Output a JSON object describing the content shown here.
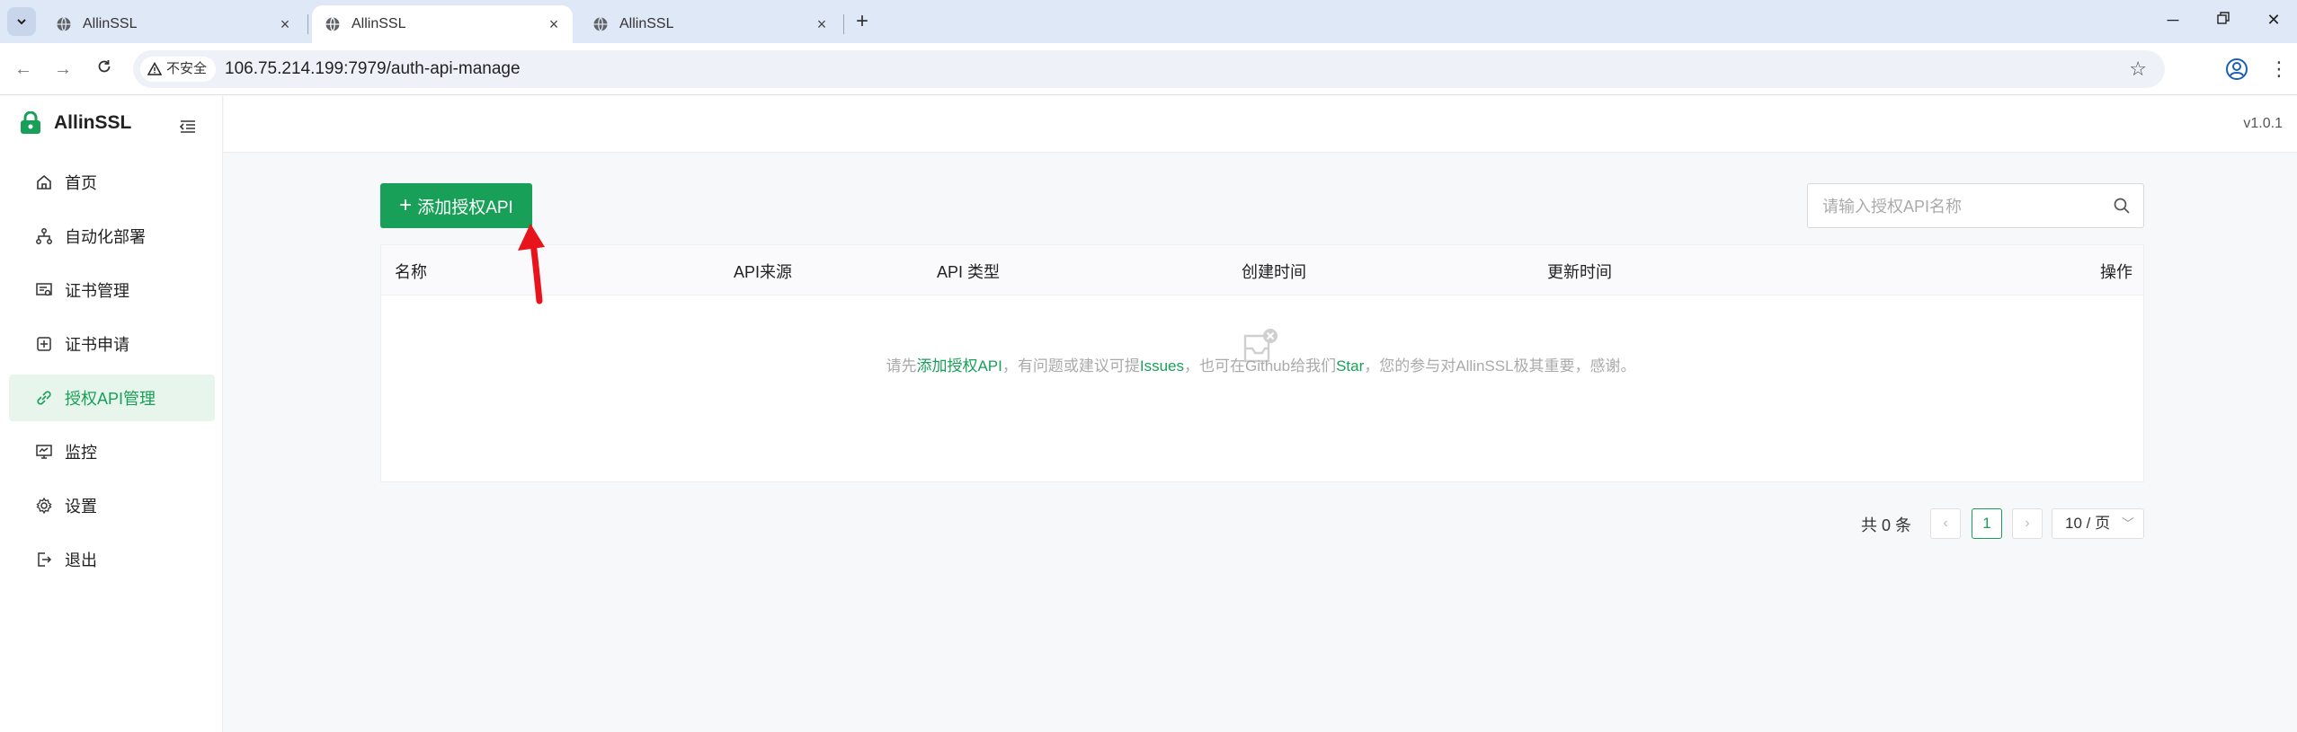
{
  "browser": {
    "tabs": [
      {
        "title": "AllinSSL",
        "active": false
      },
      {
        "title": "AllinSSL",
        "active": true
      },
      {
        "title": "AllinSSL",
        "active": false
      }
    ],
    "security_label": "不安全",
    "url": "106.75.214.199:7979/auth-api-manage"
  },
  "app": {
    "brand": "AllinSSL",
    "version": "v1.0.1",
    "menu": [
      {
        "label": "首页",
        "icon": "home-icon",
        "active": false
      },
      {
        "label": "自动化部署",
        "icon": "workflow-icon",
        "active": false
      },
      {
        "label": "证书管理",
        "icon": "certificate-icon",
        "active": false
      },
      {
        "label": "证书申请",
        "icon": "plus-square-icon",
        "active": false
      },
      {
        "label": "授权API管理",
        "icon": "link-icon",
        "active": true
      },
      {
        "label": "监控",
        "icon": "monitor-icon",
        "active": false
      },
      {
        "label": "设置",
        "icon": "gear-icon",
        "active": false
      },
      {
        "label": "退出",
        "icon": "logout-icon",
        "active": false
      }
    ]
  },
  "main": {
    "add_button": "添加授权API",
    "search_placeholder": "请输入授权API名称",
    "columns": [
      "名称",
      "API来源",
      "API 类型",
      "创建时间",
      "更新时间",
      "操作"
    ],
    "empty": {
      "prefix": "请先",
      "link1": "添加授权API",
      "middle1": "，有问题或建议可提",
      "link2": "Issues",
      "middle2": "，也可在Github给我们",
      "link3": "Star",
      "suffix": "，您的参与对AllinSSL极其重要，感谢。"
    },
    "pagination": {
      "total": "共 0 条",
      "current_page": "1",
      "page_size": "10 / 页"
    }
  },
  "colors": {
    "accent": "#18a058",
    "annotation_arrow": "#e8141b"
  }
}
